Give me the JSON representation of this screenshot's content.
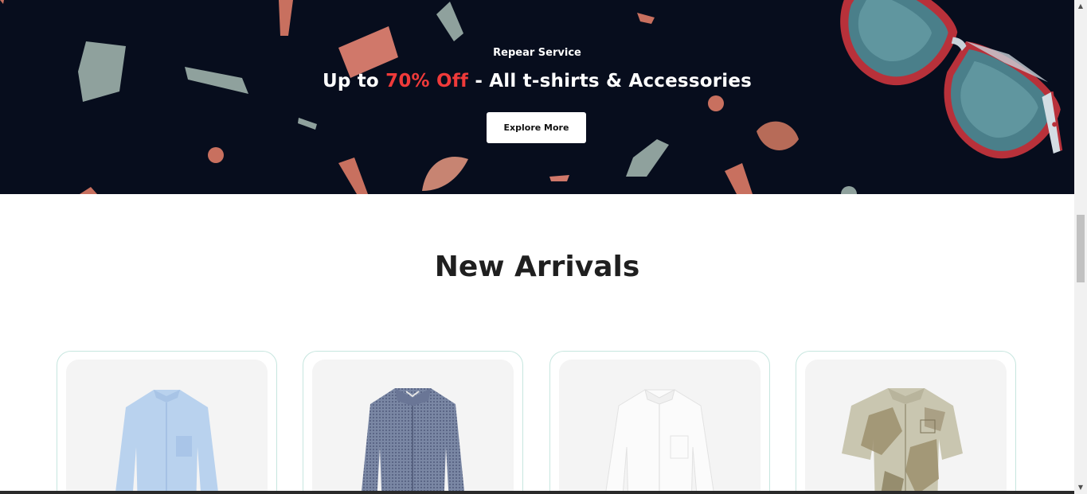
{
  "banner": {
    "subtitle": "Repear Service",
    "title_prefix": "Up to ",
    "title_highlight": "70% Off",
    "title_suffix": " - All t-shirts & Accessories",
    "button_label": "Explore More",
    "highlight_color": "#ef3a3a",
    "background_color": "#070d1d"
  },
  "section": {
    "title": "New Arrivals"
  },
  "products": [
    {
      "image": "light-blue-shirt-icon",
      "color": "#b9d2ee"
    },
    {
      "image": "blue-gingham-shirt-icon",
      "color": "#6f7c9a"
    },
    {
      "image": "white-shirt-icon",
      "color": "#f2f2f2"
    },
    {
      "image": "printed-short-sleeve-shirt-icon",
      "color": "#c9c6b0"
    }
  ],
  "scrollbar": {
    "up_arrow": "▲",
    "down_arrow": "▼"
  }
}
